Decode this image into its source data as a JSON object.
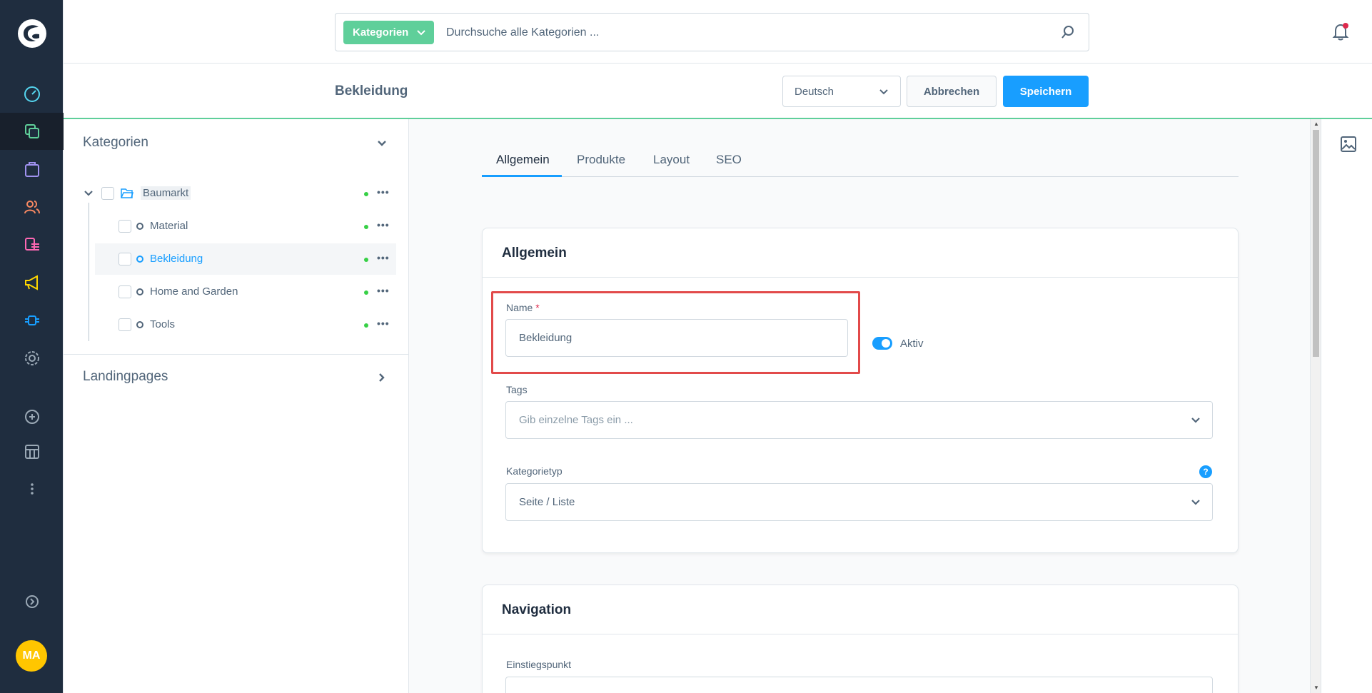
{
  "colors": {
    "sidebar_bg": "#1f2d3f",
    "accent_green": "#5fcf9a",
    "primary_blue": "#189eff",
    "status_green": "#37d046",
    "highlight_red": "#e24a4a",
    "avatar_yellow": "#ffc600"
  },
  "sidebar": {
    "items": [
      {
        "icon": "dashboard-icon"
      },
      {
        "icon": "catalog-icon",
        "active": true
      },
      {
        "icon": "orders-icon"
      },
      {
        "icon": "customers-icon"
      },
      {
        "icon": "content-icon"
      },
      {
        "icon": "marketing-icon"
      },
      {
        "icon": "extensions-icon"
      },
      {
        "icon": "settings-icon"
      },
      {
        "icon": "add-icon"
      },
      {
        "icon": "sales-channel-icon"
      },
      {
        "icon": "more-icon"
      }
    ],
    "collapse_icon": "collapse-icon",
    "avatar_initials": "MA"
  },
  "search": {
    "type_label": "Kategorien",
    "placeholder": "Durchsuche alle Kategorien ..."
  },
  "smartbar": {
    "title": "Bekleidung",
    "language": "Deutsch",
    "cancel_label": "Abbrechen",
    "save_label": "Speichern"
  },
  "tree": {
    "header": "Kategorien",
    "root": {
      "label": "Baumarkt"
    },
    "children": [
      {
        "label": "Material"
      },
      {
        "label": "Bekleidung",
        "selected": true
      },
      {
        "label": "Home and Garden"
      },
      {
        "label": "Tools"
      }
    ],
    "more_label": "•••",
    "landingpages": "Landingpages"
  },
  "tabs": [
    "Allgemein",
    "Produkte",
    "Layout",
    "SEO"
  ],
  "general_card": {
    "title": "Allgemein",
    "name_label": "Name",
    "required_mark": "*",
    "name_value": "Bekleidung",
    "active_label": "Aktiv",
    "tags_label": "Tags",
    "tags_placeholder": "Gib einzelne Tags ein ...",
    "category_type_label": "Kategorietyp",
    "category_type_value": "Seite / Liste",
    "help_label": "?"
  },
  "navigation_card": {
    "title": "Navigation",
    "entry_point_label": "Einstiegspunkt"
  }
}
